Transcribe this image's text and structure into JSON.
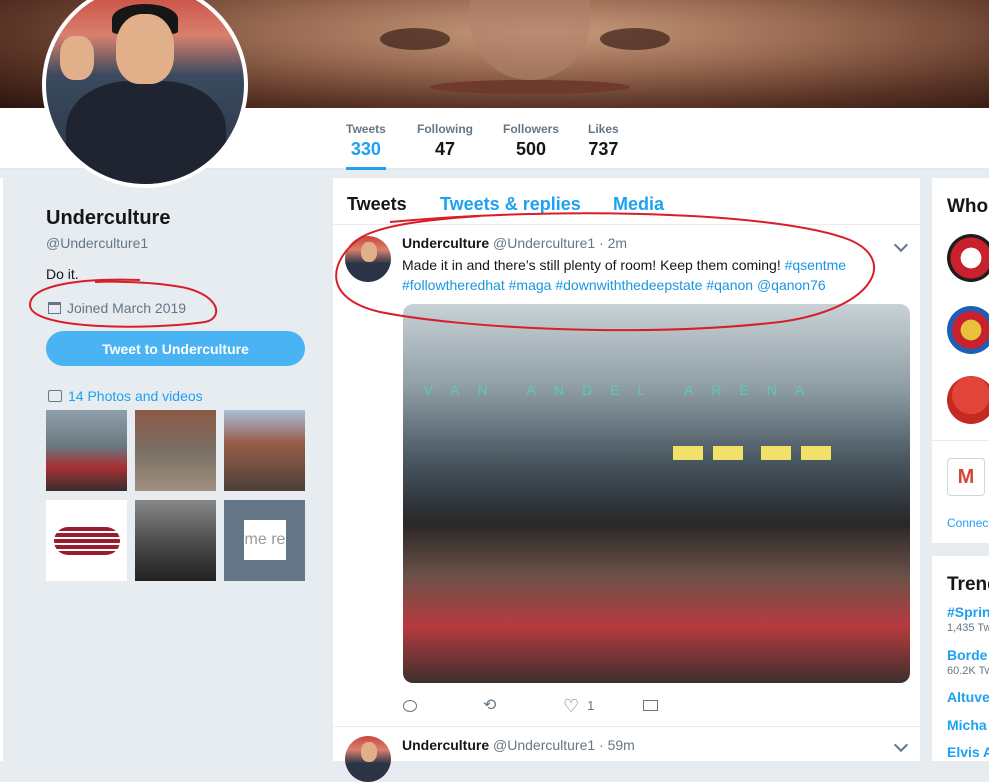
{
  "profile": {
    "name": "Underculture",
    "handle": "@Underculture1",
    "bio": "Do it.",
    "joined": "Joined March 2019",
    "tweet_to_label": "Tweet to Underculture",
    "photos_label": "14 Photos and videos",
    "thumb6_text": "me re"
  },
  "stats": [
    {
      "label": "Tweets",
      "value": "330"
    },
    {
      "label": "Following",
      "value": "47"
    },
    {
      "label": "Followers",
      "value": "500"
    },
    {
      "label": "Likes",
      "value": "737"
    }
  ],
  "timeline": {
    "tabs": [
      "Tweets",
      "Tweets & replies",
      "Media"
    ],
    "tweets": [
      {
        "name": "Underculture",
        "handle": "@Underculture1",
        "time": "· 2m",
        "text_plain": "Made it in and there’s still plenty of room! Keep them coming!",
        "tags": [
          "#qsentme",
          "#followtheredhat",
          "#maga",
          "#downwiththedeepstate",
          "#qanon",
          "@qanon76"
        ],
        "photo_text": "VAN ANDEL ARENA",
        "likes": "1"
      },
      {
        "name": "Underculture",
        "handle": "@Underculture1",
        "time": "· 59m"
      }
    ]
  },
  "right": {
    "who_title": "Who",
    "connect_label": "Connect",
    "trends_title": "Trend",
    "trends": [
      {
        "name": "#Sprin",
        "sub": "1,435 Tw"
      },
      {
        "name": "Borde",
        "sub": "60.2K Tw"
      },
      {
        "name": "Altuve",
        "sub": ""
      },
      {
        "name": "Micha",
        "sub": ""
      },
      {
        "name": "Elvis A",
        "sub": ""
      }
    ]
  },
  "colors": {
    "accent": "#1da1f2",
    "annotation": "#d81e2a"
  }
}
